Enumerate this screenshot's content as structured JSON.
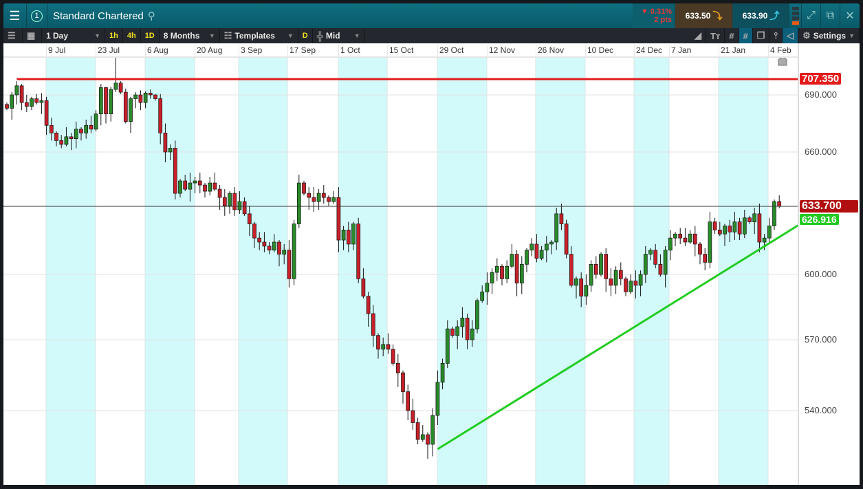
{
  "header": {
    "title": "Standard Chartered",
    "badge": "1",
    "change_pct": "▼ 0.31%",
    "change_pts": "2 pts",
    "sell": "633.50",
    "buy": "633.90"
  },
  "toolbar": {
    "interval": "1 Day",
    "quick": [
      "1h",
      "4h",
      "1D"
    ],
    "range": "8 Months",
    "templates": "Templates",
    "d": "D",
    "price_type": "Mid",
    "settings": "Settings"
  },
  "dates": [
    "9 Jul",
    "23 Jul",
    "6 Aug",
    "20 Aug",
    "3 Sep",
    "17 Sep",
    "1 Oct",
    "15 Oct",
    "29 Oct",
    "12 Nov",
    "26 Nov",
    "10 Dec",
    "24 Dec",
    "7 Jan",
    "21 Jan",
    "4 Feb"
  ],
  "axis": {
    "ticks": [
      "690.000",
      "660.000",
      "600.000",
      "570.000",
      "540.000"
    ]
  },
  "levels": {
    "resistance": "707.350",
    "current": "633.700",
    "trend": "626.916"
  },
  "colors": {
    "up": "#2a8a2a",
    "down": "#c8202a",
    "resistance": "#e01b1b",
    "trend": "#22cc22"
  },
  "chart_data": {
    "type": "candlestick",
    "closes": [
      683,
      690,
      700,
      686,
      684,
      688,
      686,
      687,
      674,
      670,
      666,
      664,
      668,
      667,
      672,
      670,
      674,
      672,
      680,
      698,
      680,
      696,
      703,
      693,
      676,
      688,
      690,
      686,
      692,
      690,
      688,
      670,
      660,
      662,
      640,
      646,
      642,
      645,
      646,
      644,
      641,
      645,
      642,
      638,
      634,
      640,
      632,
      636,
      630,
      625,
      618,
      616,
      614,
      612,
      616,
      610,
      612,
      598,
      625,
      645,
      640,
      638,
      636,
      640,
      638,
      636,
      638,
      617,
      622,
      615,
      625,
      598,
      590,
      582,
      572,
      566,
      568,
      566,
      560,
      556,
      548,
      540,
      535,
      528,
      530,
      526,
      538,
      552,
      560,
      575,
      572,
      576,
      580,
      570,
      575,
      588,
      592,
      596,
      601,
      604,
      598,
      604,
      610,
      596,
      605,
      612,
      615,
      608,
      612,
      615,
      616,
      630,
      625,
      610,
      595,
      598,
      590,
      595,
      605,
      600,
      610,
      598,
      595,
      602,
      598,
      592,
      597,
      595,
      600,
      610,
      612,
      605,
      600,
      612,
      618,
      620,
      618,
      616,
      620,
      615,
      610,
      606,
      626,
      622,
      620,
      624,
      621,
      626,
      620,
      628,
      626,
      630,
      616,
      618,
      624,
      636,
      633.7
    ],
    "resistance": 707.35,
    "current": 633.7,
    "trendline": {
      "start_index": 87,
      "start_price": 524,
      "end_price": 626.916
    }
  }
}
